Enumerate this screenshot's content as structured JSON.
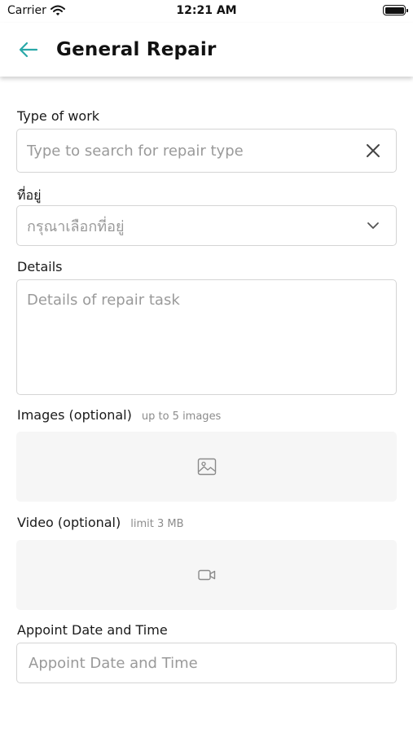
{
  "status_bar": {
    "carrier": "Carrier",
    "time": "12:21 AM"
  },
  "nav": {
    "title": "General Repair",
    "accent": "#2aa8a8"
  },
  "form": {
    "type_of_work": {
      "label": "Type of work",
      "placeholder": "Type to search for repair type"
    },
    "address": {
      "label": "ที่อยู่",
      "placeholder": "กรุณาเลือกที่อยู่"
    },
    "details": {
      "label": "Details",
      "placeholder": "Details of repair task"
    },
    "images": {
      "label": "Images (optional)",
      "hint": "up to 5 images"
    },
    "video": {
      "label": "Video (optional)",
      "hint": "limit 3 MB"
    },
    "appointment": {
      "label": "Appoint Date and Time",
      "placeholder": "Appoint Date and Time"
    }
  }
}
